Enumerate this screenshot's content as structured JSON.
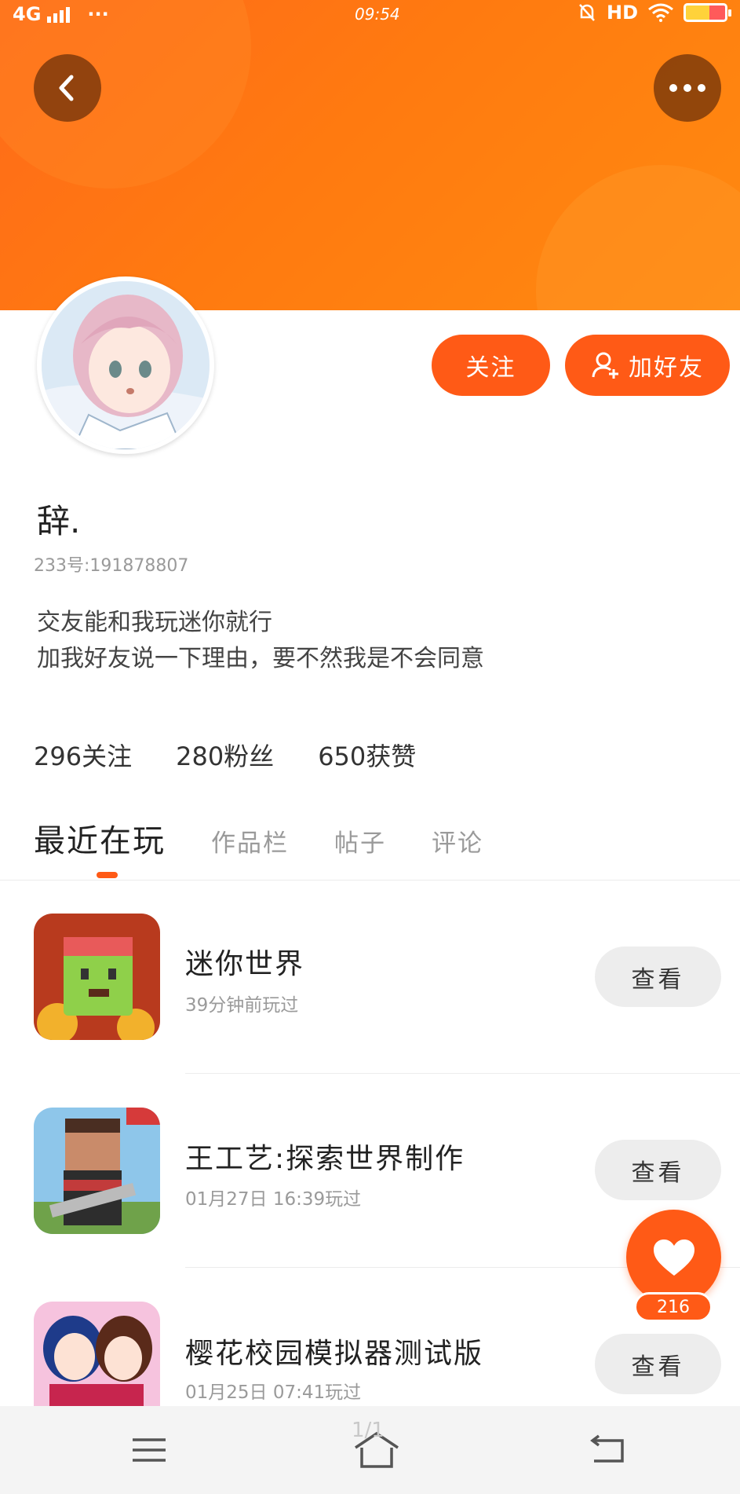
{
  "status_bar": {
    "network": "4G",
    "more": "···",
    "time": "09:54",
    "hd": "HD"
  },
  "profile": {
    "nickname": "辞.",
    "uid": "233号:191878807",
    "bio_lines": [
      "交友能和我玩迷你就行",
      "加我好友说一下理由，要不然我是不会同意"
    ],
    "follow_label": "关注",
    "add_friend_label": "加好友"
  },
  "stats": [
    {
      "label": "296关注"
    },
    {
      "label": "280粉丝"
    },
    {
      "label": "650获赞"
    }
  ],
  "tabs": [
    {
      "label": "最近在玩",
      "active": true
    },
    {
      "label": "作品栏",
      "active": false
    },
    {
      "label": "帖子",
      "active": false
    },
    {
      "label": "评论",
      "active": false
    }
  ],
  "games": [
    {
      "title": "迷你世界",
      "time": "39分钟前玩过",
      "button": "查看"
    },
    {
      "title": "王工艺:探索世界制作",
      "time": "01月27日 16:39玩过",
      "button": "查看"
    },
    {
      "title": "樱花校园模拟器测试版",
      "time": "01月25日 07:41玩过",
      "button": "查看"
    }
  ],
  "like": {
    "count": "216"
  },
  "nav": {
    "page_indicator": "1/1"
  },
  "colors": {
    "accent": "#ff5a16",
    "banner": "#ff7a10",
    "muted": "#9a9a9a"
  }
}
